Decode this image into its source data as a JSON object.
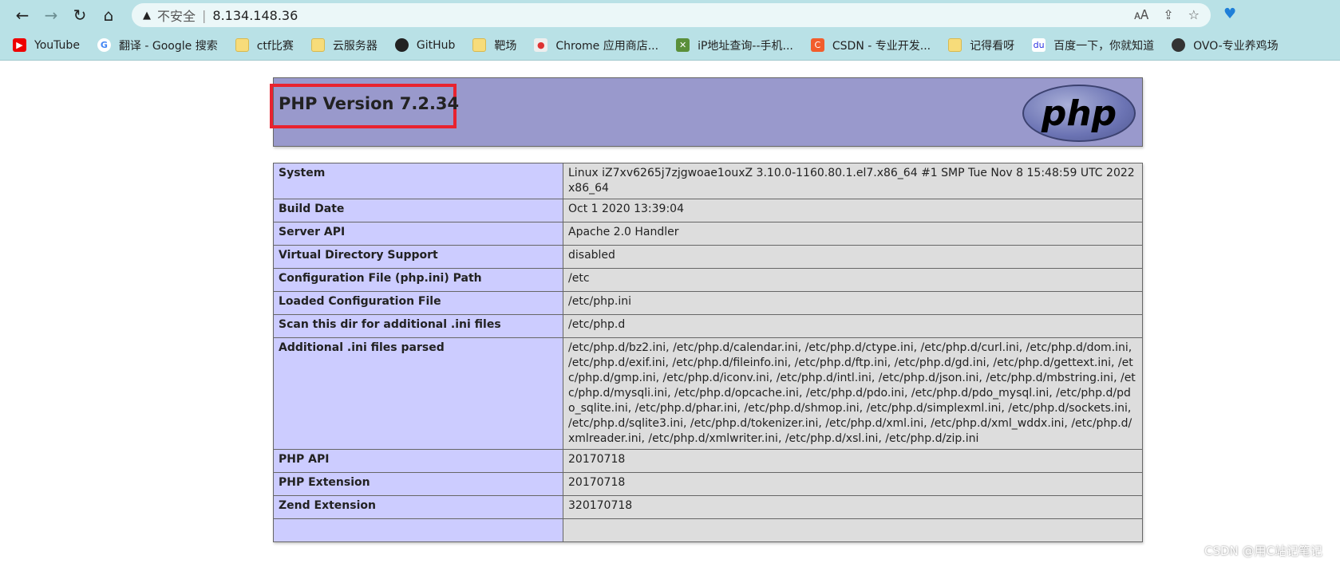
{
  "browser": {
    "security_label": "不安全",
    "url": "8.134.148.36",
    "bookmarks": [
      {
        "label": "YouTube",
        "icon": "youtube-icon"
      },
      {
        "label": "翻译 - Google 搜索",
        "icon": "google-icon"
      },
      {
        "label": "ctf比赛",
        "icon": "folder-icon"
      },
      {
        "label": "云服务器",
        "icon": "folder-icon"
      },
      {
        "label": "GitHub",
        "icon": "github-icon"
      },
      {
        "label": "靶场",
        "icon": "folder-icon"
      },
      {
        "label": "Chrome 应用商店...",
        "icon": "chrome-webstore-icon"
      },
      {
        "label": "iP地址查询--手机...",
        "icon": "ip-icon"
      },
      {
        "label": "CSDN - 专业开发...",
        "icon": "csdn-icon"
      },
      {
        "label": "记得看呀",
        "icon": "folder-icon"
      },
      {
        "label": "百度一下，你就知道",
        "icon": "baidu-icon"
      },
      {
        "label": "OVO-专业养鸡场",
        "icon": "globe-icon"
      }
    ]
  },
  "page": {
    "title": "PHP Version 7.2.34",
    "logo_text": "php",
    "rows": [
      {
        "k": "System",
        "v": "Linux iZ7xv6265j7zjgwoae1ouxZ 3.10.0-1160.80.1.el7.x86_64 #1 SMP Tue Nov 8 15:48:59 UTC 2022 x86_64"
      },
      {
        "k": "Build Date",
        "v": "Oct 1 2020 13:39:04"
      },
      {
        "k": "Server API",
        "v": "Apache 2.0 Handler"
      },
      {
        "k": "Virtual Directory Support",
        "v": "disabled"
      },
      {
        "k": "Configuration File (php.ini) Path",
        "v": "/etc"
      },
      {
        "k": "Loaded Configuration File",
        "v": "/etc/php.ini"
      },
      {
        "k": "Scan this dir for additional .ini files",
        "v": "/etc/php.d"
      },
      {
        "k": "Additional .ini files parsed",
        "v": "/etc/php.d/bz2.ini, /etc/php.d/calendar.ini, /etc/php.d/ctype.ini, /etc/php.d/curl.ini, /etc/php.d/dom.ini, /etc/php.d/exif.ini, /etc/php.d/fileinfo.ini, /etc/php.d/ftp.ini, /etc/php.d/gd.ini, /etc/php.d/gettext.ini, /etc/php.d/gmp.ini, /etc/php.d/iconv.ini, /etc/php.d/intl.ini, /etc/php.d/json.ini, /etc/php.d/mbstring.ini, /etc/php.d/mysqli.ini, /etc/php.d/opcache.ini, /etc/php.d/pdo.ini, /etc/php.d/pdo_mysql.ini, /etc/php.d/pdo_sqlite.ini, /etc/php.d/phar.ini, /etc/php.d/shmop.ini, /etc/php.d/simplexml.ini, /etc/php.d/sockets.ini, /etc/php.d/sqlite3.ini, /etc/php.d/tokenizer.ini, /etc/php.d/xml.ini, /etc/php.d/xml_wddx.ini, /etc/php.d/xmlreader.ini, /etc/php.d/xmlwriter.ini, /etc/php.d/xsl.ini, /etc/php.d/zip.ini"
      },
      {
        "k": "PHP API",
        "v": "20170718"
      },
      {
        "k": "PHP Extension",
        "v": "20170718"
      },
      {
        "k": "Zend Extension",
        "v": "320170718"
      },
      {
        "k": "",
        "v": ""
      }
    ]
  },
  "watermark": "CSDN @用C站记笔记",
  "colors": {
    "header": "#9999cc",
    "label_cell": "#ccccff",
    "value_cell": "#dddddd",
    "highlight": "#e8232f"
  }
}
